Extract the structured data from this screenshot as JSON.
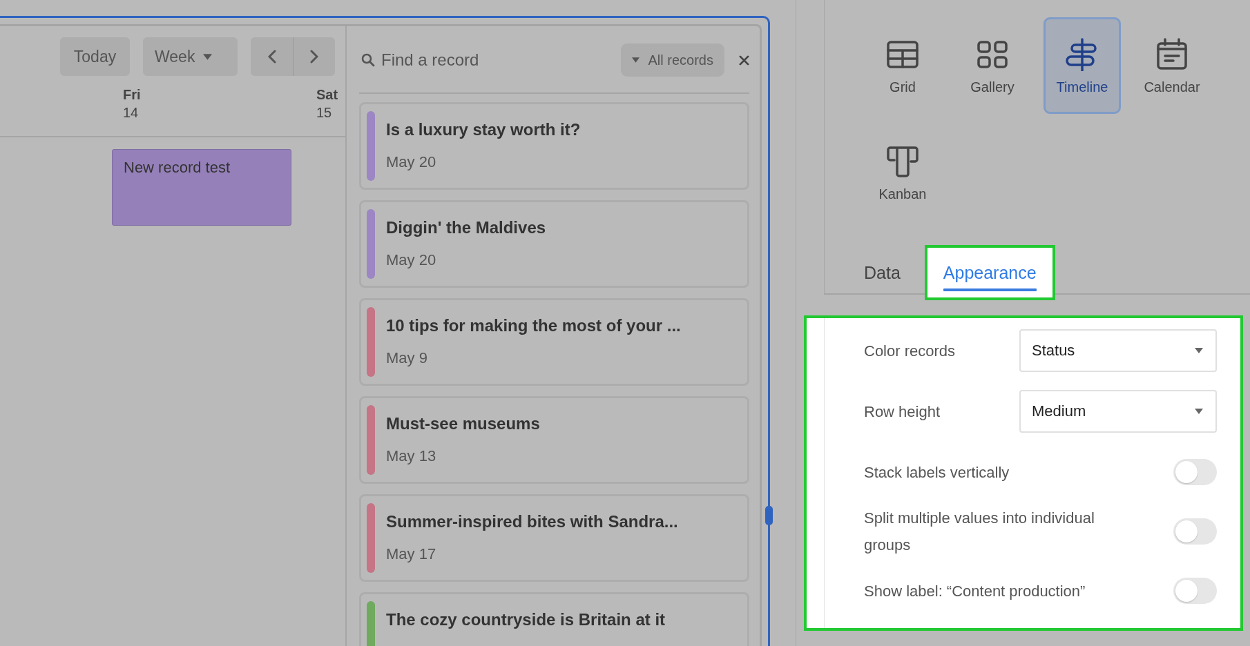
{
  "calendar": {
    "toolbar": {
      "today": "Today",
      "range": "Week"
    },
    "days": [
      {
        "name": "Fri",
        "date": "14"
      },
      {
        "name": "Sat",
        "date": "15"
      }
    ],
    "events": [
      {
        "title": "New record test",
        "color": "#9580b9"
      }
    ]
  },
  "record_panel": {
    "search": {
      "placeholder": "Find a record"
    },
    "filter": "All records",
    "records": [
      {
        "title": "Is a luxury stay worth it?",
        "date": "May 20",
        "color": "#9d86c4"
      },
      {
        "title": "Diggin' the Maldives",
        "date": "May 20",
        "color": "#9d86c4"
      },
      {
        "title": "10 tips for making the most of your ...",
        "date": "May 9",
        "color": "#c57585"
      },
      {
        "title": "Must-see museums",
        "date": "May 13",
        "color": "#c57585"
      },
      {
        "title": "Summer-inspired bites with Sandra...",
        "date": "May 17",
        "color": "#c57585"
      },
      {
        "title": "The cozy countryside is Britain at it",
        "color": "#6faa5e"
      }
    ]
  },
  "views": [
    {
      "label": "Grid",
      "kind": "grid",
      "selected": false
    },
    {
      "label": "Gallery",
      "kind": "gallery",
      "selected": false
    },
    {
      "label": "Timeline",
      "kind": "timeline",
      "selected": true
    },
    {
      "label": "Calendar",
      "kind": "calendar",
      "selected": false
    },
    {
      "label": "Kanban",
      "kind": "kanban",
      "selected": false
    }
  ],
  "tabs": [
    {
      "label": "Data",
      "selected": false,
      "highlighted": false
    },
    {
      "label": "Appearance",
      "selected": true,
      "highlighted": true
    }
  ],
  "appearance": {
    "highlighted": true,
    "settings": [
      {
        "kind": "select",
        "label": "Color records",
        "value": "Status"
      },
      {
        "kind": "select",
        "label": "Row height",
        "value": "Medium"
      },
      {
        "kind": "toggle",
        "label": "Stack labels vertically",
        "on": false
      },
      {
        "kind": "toggle",
        "label": "Split multiple values into individual groups",
        "on": false
      },
      {
        "kind": "toggle",
        "label": "Show label: “Content production”",
        "on": false
      }
    ]
  }
}
